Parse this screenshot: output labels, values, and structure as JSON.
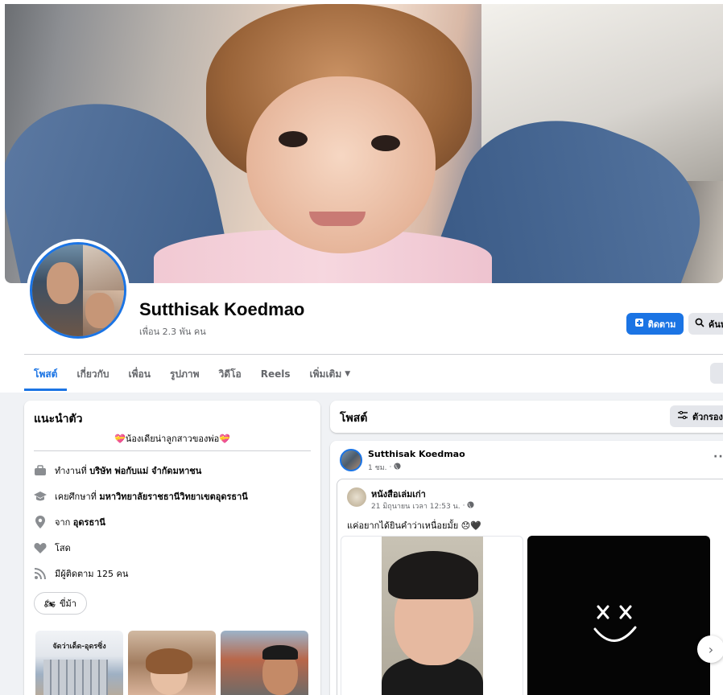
{
  "profile": {
    "name": "Sutthisak Koedmao",
    "friends": "เพื่อน 2.3 พัน คน"
  },
  "actions": {
    "follow_label": "ติดตาม",
    "search_label": "ค้นหา"
  },
  "tabs": [
    {
      "label": "โพสต์"
    },
    {
      "label": "เกี่ยวกับ"
    },
    {
      "label": "เพื่อน"
    },
    {
      "label": "รูปภาพ"
    },
    {
      "label": "วิดีโอ"
    },
    {
      "label": "Reels"
    },
    {
      "label": "เพิ่มเติม"
    }
  ],
  "intro": {
    "title": "แนะนำตัว",
    "bio": "💝น้องเดียน่าลูกสาวของพ่อ💝",
    "items": [
      {
        "icon": "briefcase-icon",
        "prefix": "ทำงานที่ ",
        "value": "บริษัท พ่อกับแม่ จำกัดมหาชน"
      },
      {
        "icon": "graduation-cap-icon",
        "prefix": "เคยศึกษาที่ ",
        "value": "มหาวิทยาลัยราชธานีวิทยาเขตอุดรธานี"
      },
      {
        "icon": "location-pin-icon",
        "prefix": "จาก ",
        "value": "อุดรธานี"
      },
      {
        "icon": "heart-icon",
        "prefix": "",
        "value": "โสด"
      },
      {
        "icon": "rss-icon",
        "prefix": "",
        "value": "มีผู้ติดตาม 125 คน"
      }
    ],
    "hobby": {
      "icon": "🏍",
      "label": "ขี่ม้า"
    },
    "photo_caption": "จัดว่าเด็ด-อุดรซิ่ง"
  },
  "posts": {
    "title": "โพสต์",
    "filter_label": "ตัวกรอง"
  },
  "post": {
    "author": "Sutthisak Koedmao",
    "time": "1 ชม.",
    "shared": {
      "name": "หนังสือเล่มเก่า",
      "time": "21 มิถุนายน เวลา 12:53 น.",
      "text": "แค่อยากได้ยินคำว่าเหนื่อยมั้ย 😞🖤"
    }
  },
  "colors": {
    "accent": "#1b74e4",
    "background": "#f0f2f5",
    "secondary_text": "#65676b"
  }
}
